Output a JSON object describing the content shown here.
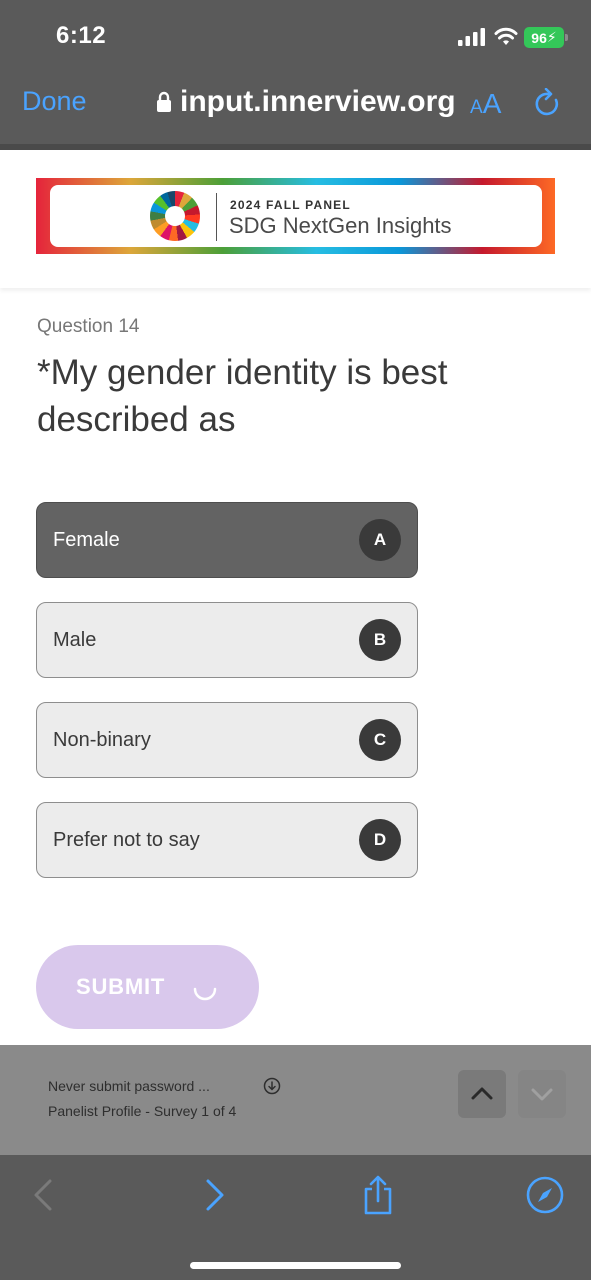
{
  "status_bar": {
    "time": "6:12",
    "battery": "96"
  },
  "browser": {
    "done_label": "Done",
    "url": "input.innerview.org",
    "aa_small": "A",
    "aa_large": "A"
  },
  "banner": {
    "kicker": "2024 FALL PANEL",
    "title": "SDG NextGen Insights"
  },
  "question": {
    "number": "Question 14",
    "text": "*My gender identity is best described as",
    "options": [
      {
        "label": "Female",
        "key": "A",
        "selected": true
      },
      {
        "label": "Male",
        "key": "B",
        "selected": false
      },
      {
        "label": "Non-binary",
        "key": "C",
        "selected": false
      },
      {
        "label": "Prefer not to say",
        "key": "D",
        "selected": false
      }
    ]
  },
  "submit_label": "SUBMIT",
  "find_bar": {
    "line1": "Never submit password ...",
    "line2": "Panelist Profile - Survey 1 of 4"
  },
  "colors": {
    "accent": "#4aa3ff",
    "selected_option": "#636363",
    "submit_bg": "#d9c8ec",
    "battery": "#34c759"
  },
  "icons": [
    "signal-icon",
    "wifi-icon",
    "lock-icon",
    "reload-icon",
    "spinner-icon",
    "info-icon",
    "chevron-up-icon",
    "chevron-down-icon",
    "back-icon",
    "forward-icon",
    "share-icon",
    "compass-icon"
  ]
}
